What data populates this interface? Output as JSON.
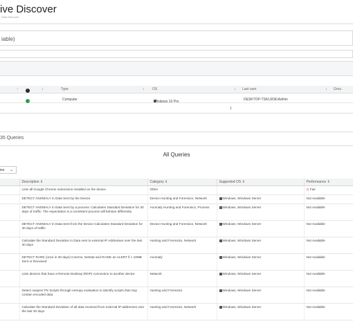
{
  "app": {
    "title": "ive Discover",
    "subtitle": "Data Discover"
  },
  "variable": {
    "text": "iable)"
  },
  "devices": {
    "columns": [
      "Type",
      "OS",
      "Last user",
      "Grou"
    ],
    "row": {
      "type": "Computer",
      "os": "Windows 10 Pro",
      "last_user": "DESKTOP-TSKUJDE\\Admin"
    },
    "page": "1"
  },
  "queries": {
    "count_label": "35 Queries",
    "panel_title": "All Queries",
    "filter_label": "ies",
    "columns": [
      "Description",
      "Category",
      "Supported OS",
      "Performance"
    ],
    "rows": [
      {
        "desc": "Lists all Google Chrome extensions installed on the device",
        "category": "Other",
        "os": "",
        "perf": "Fair"
      },
      {
        "desc": "DETECT ANOMALY in Data Sent by the Device",
        "category": "Device Hunting and Forensics, Network",
        "os": "Windows, Windows Server",
        "perf": "Not Available"
      },
      {
        "desc": "DETECT ANOMALY in Data Sent by a process: Calculates Standard Deviation for 30 days of traffic. The expectation is a consistent process will behave differently.",
        "category": "Anomaly Hunting and Forensics, Process",
        "os": "Windows, Windows Server",
        "perf": "Not Available"
      },
      {
        "desc": "DETECT ANOMALY in Data Sent from the Device Calculates Standard Deviation for 30 days of traffic",
        "category": "Device Hunting and Forensics, Network",
        "os": "Windows, Windows Server",
        "perf": "Not Available"
      },
      {
        "desc": "Calculate the Standard Deviation in Data sent to external IP Addresses over the last 30 days",
        "category": "Hunting and Forensics, Network",
        "os": "Windows, Windows Server",
        "perf": "Not Available"
      },
      {
        "desc": "DETECT RARE (once in 30 days) Comms, Netstat and RAISE an ALERT if > 10MB Sent or Received",
        "category": "Anomaly",
        "os": "Windows, Windows Server",
        "perf": "Not Available"
      },
      {
        "desc": "Lists devices that have a Remote Desktop (RDP) connection to another device",
        "category": "Network",
        "os": "Windows, Windows Server",
        "perf": "Not Available"
      },
      {
        "desc": "Detect suspect PS Scripts through entropy evaluation to identify scripts that may contain encoded data",
        "category": "Hunting and Forensics",
        "os": "Windows, Windows Server",
        "perf": "Not Available"
      },
      {
        "desc": "Calculate the Standard Deviation of all data received from external IP addresses over the last 30 days",
        "category": "Hunting and Forensics, Network",
        "os": "Windows, Windows Server",
        "perf": "Not Available"
      }
    ]
  }
}
